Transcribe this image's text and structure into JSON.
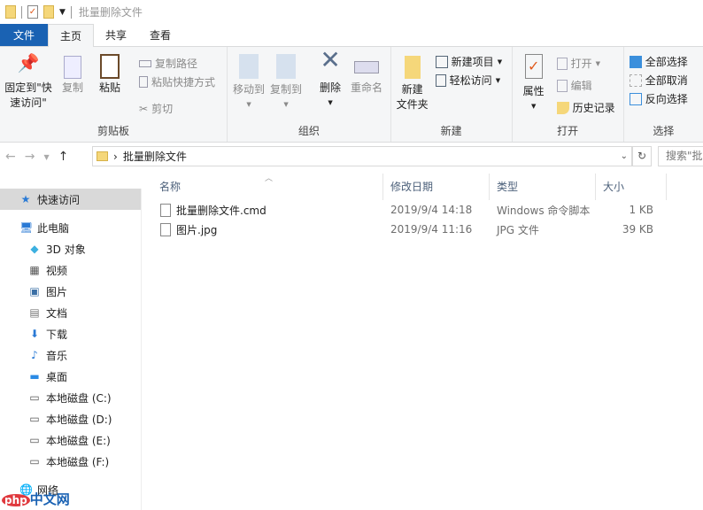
{
  "window": {
    "title": "批量删除文件"
  },
  "tabs": [
    "文件",
    "主页",
    "共享",
    "查看"
  ],
  "ribbon": {
    "clipboard": {
      "label": "剪贴板",
      "pin": "固定到\"快速访问\"",
      "pin_l1": "固定到\"快",
      "pin_l2": "速访问\"",
      "copy": "复制",
      "paste": "粘贴",
      "copy_path": "复制路径",
      "paste_shortcut": "粘贴快捷方式",
      "cut": "剪切"
    },
    "organize": {
      "label": "组织",
      "move_to": "移动到",
      "copy_to": "复制到",
      "delete": "删除",
      "rename": "重命名"
    },
    "new": {
      "label": "新建",
      "new_folder_l1": "新建",
      "new_folder_l2": "文件夹",
      "new_item": "新建项目",
      "easy_access": "轻松访问"
    },
    "open": {
      "label": "打开",
      "properties": "属性",
      "open": "打开",
      "edit": "编辑",
      "history": "历史记录"
    },
    "select": {
      "label": "选择",
      "select_all": "全部选择",
      "select_none": "全部取消",
      "invert": "反向选择"
    }
  },
  "address": {
    "path": "批量删除文件",
    "search_placeholder": "搜索\"批"
  },
  "sidebar": [
    {
      "label": "快速访问",
      "icon": "star-icon",
      "level": 0
    },
    {
      "label": "此电脑",
      "icon": "computer-icon",
      "level": 0
    },
    {
      "label": "3D 对象",
      "icon": "cube-icon",
      "level": 1
    },
    {
      "label": "视频",
      "icon": "video-icon",
      "level": 1
    },
    {
      "label": "图片",
      "icon": "picture-icon",
      "level": 1
    },
    {
      "label": "文档",
      "icon": "document-icon",
      "level": 1
    },
    {
      "label": "下载",
      "icon": "download-icon",
      "level": 1
    },
    {
      "label": "音乐",
      "icon": "music-icon",
      "level": 1
    },
    {
      "label": "桌面",
      "icon": "desktop-icon",
      "level": 1
    },
    {
      "label": "本地磁盘 (C:)",
      "icon": "drive-icon",
      "level": 1
    },
    {
      "label": "本地磁盘 (D:)",
      "icon": "drive-icon",
      "level": 1
    },
    {
      "label": "本地磁盘 (E:)",
      "icon": "drive-icon",
      "level": 1
    },
    {
      "label": "本地磁盘 (F:)",
      "icon": "drive-icon",
      "level": 1
    },
    {
      "label": "网络",
      "icon": "network-icon",
      "level": 0
    }
  ],
  "columns": [
    "名称",
    "修改日期",
    "类型",
    "大小"
  ],
  "files": [
    {
      "name": "批量删除文件.cmd",
      "date": "2019/9/4 14:18",
      "type": "Windows 命令脚本",
      "size": "1 KB"
    },
    {
      "name": "图片.jpg",
      "date": "2019/9/4 11:16",
      "type": "JPG 文件",
      "size": "39 KB"
    }
  ],
  "watermark": "php中文网"
}
